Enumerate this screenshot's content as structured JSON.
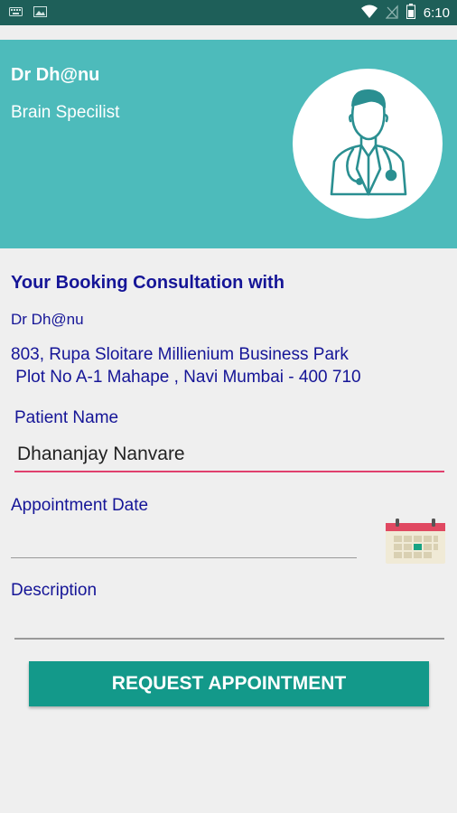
{
  "status_bar": {
    "time": "6:10",
    "left_icons": [
      "keyboard-icon",
      "image-icon"
    ],
    "right_icons": [
      "wifi-icon",
      "no-signal-icon",
      "battery-icon"
    ]
  },
  "header": {
    "doctor_name": "Dr Dh@nu",
    "specialty": "Brain Specilist",
    "avatar_icon": "doctor-icon",
    "background_color": "#4dbbbb"
  },
  "booking": {
    "title": "Your Booking Consultation with",
    "doctor": "Dr Dh@nu",
    "address_line1": "803, Rupa Sloitare Millienium Business Park",
    "address_line2": " Plot No A-1 Mahape , Navi Mumbai - 400 710"
  },
  "form": {
    "patient_label": "Patient Name",
    "patient_value": "Dhananjay Nanvare",
    "date_label": "Appointment Date",
    "date_value": "",
    "calendar_icon": "calendar-icon",
    "description_label": "Description",
    "description_value": ""
  },
  "actions": {
    "request_label": "REQUEST APPOINTMENT",
    "button_color": "#13998a"
  }
}
